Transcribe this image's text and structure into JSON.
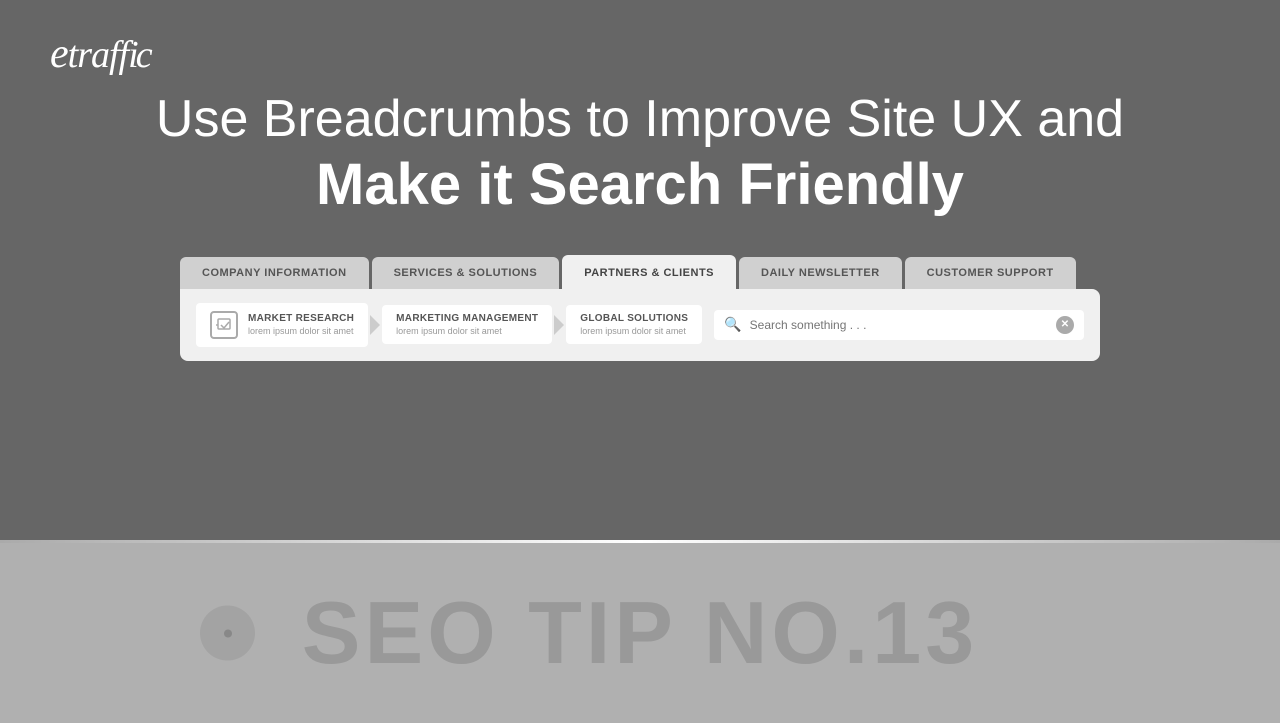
{
  "logo": {
    "text": "etraffic"
  },
  "header": {
    "line1": "Use Breadcrumbs to Improve Site UX and",
    "line2": "Make it Search Friendly"
  },
  "nav_tabs": [
    {
      "id": "company",
      "label": "COMPANY INFORMATION",
      "active": false
    },
    {
      "id": "services",
      "label": "SERVICES & SOLUTIONS",
      "active": false
    },
    {
      "id": "partners",
      "label": "PARTNERS & CLIENTS",
      "active": true
    },
    {
      "id": "newsletter",
      "label": "DAILY NEWSLETTER",
      "active": false
    },
    {
      "id": "support",
      "label": "CUSTOMER SUPPORT",
      "active": false
    }
  ],
  "breadcrumbs": [
    {
      "title": "MARKET RESEARCH",
      "subtitle": "lorem ipsum dolor sit amet",
      "has_icon": true
    },
    {
      "title": "MARKETING MANAGEMENT",
      "subtitle": "lorem ipsum dolor sit amet",
      "has_icon": false
    },
    {
      "title": "GLOBAL SOLUTIONS",
      "subtitle": "lorem ipsum dolor sit amet",
      "has_icon": false
    }
  ],
  "search": {
    "placeholder": "Search something . . ."
  },
  "bottom": {
    "text": "SEO TIP NO.13"
  }
}
